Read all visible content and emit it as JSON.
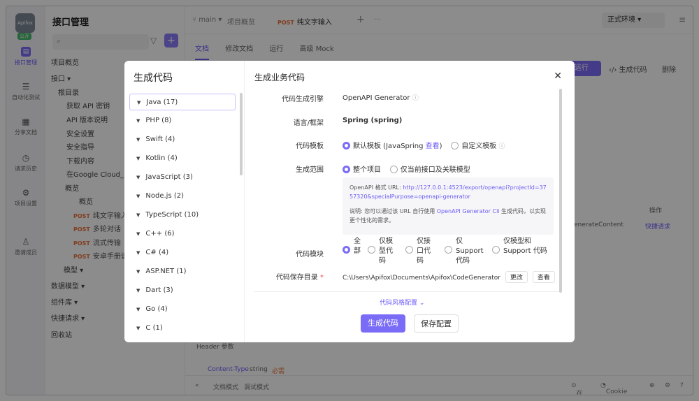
{
  "rail": {
    "logo": "Apifox",
    "open_badge": "公开",
    "items": [
      {
        "label": "接口管理",
        "icon": "api-icon"
      },
      {
        "label": "自动化测试",
        "icon": "test-icon"
      },
      {
        "label": "分享文档",
        "icon": "share-doc-icon"
      },
      {
        "label": "请求历史",
        "icon": "history-icon"
      },
      {
        "label": "项目设置",
        "icon": "settings-icon"
      },
      {
        "label": "邀请成员",
        "icon": "invite-icon"
      }
    ]
  },
  "tree": {
    "title": "接口管理",
    "search_icon": "search-icon",
    "nodes": [
      {
        "label": "项目概览"
      },
      {
        "label": "接口 ▾"
      },
      {
        "label": "根目录"
      },
      {
        "label": "获取 API 密钥"
      },
      {
        "label": "API 版本说明"
      },
      {
        "label": "安全设置"
      },
      {
        "label": "安全指导"
      },
      {
        "label": "下载内容"
      },
      {
        "label": "在Google Cloud_"
      },
      {
        "label": "概览"
      },
      {
        "label": "概览"
      },
      {
        "label": "纯文字输入",
        "method": "POST"
      },
      {
        "label": "多轮对话（",
        "method": "POST"
      },
      {
        "label": "流式传输",
        "method": "POST"
      },
      {
        "label": "安卓手册说明",
        "method": "POST"
      },
      {
        "label": "模型 ▾"
      },
      {
        "label": "数据模型 ▾"
      },
      {
        "label": "组件库 ▾"
      },
      {
        "label": "快捷请求 ▾"
      },
      {
        "label": "回收站"
      }
    ]
  },
  "topbar": {
    "branch": "main",
    "overview_tab": "项目概览",
    "active_tab_method": "POST",
    "active_tab_label": "纯文字输入",
    "env": "正式环境"
  },
  "subtabs": [
    "文档",
    "修改文档",
    "运行",
    "高级 Mock"
  ],
  "toolbar": {
    "run": "运行",
    "generate": "生成代码",
    "delete": "删除"
  },
  "background": {
    "header_params": "Header 参数",
    "content_type": "Content-Type",
    "string": "string",
    "required": "必需",
    "ops": "操作",
    "generate_content": "enerateContent",
    "quick_request": "快捷请求"
  },
  "statusbar": {
    "doc_mode": "文档模式",
    "debug_mode": "调试模式",
    "online": "在线",
    "cookie": "Cookie 管理"
  },
  "modal": {
    "left_title": "生成代码",
    "languages": [
      {
        "name": "Java",
        "count": "(17)"
      },
      {
        "name": "PHP",
        "count": "(8)"
      },
      {
        "name": "Swift",
        "count": "(4)"
      },
      {
        "name": "Kotlin",
        "count": "(4)"
      },
      {
        "name": "JavaScript",
        "count": "(3)"
      },
      {
        "name": "Node.js",
        "count": "(2)"
      },
      {
        "name": "TypeScript",
        "count": "(10)"
      },
      {
        "name": "C++",
        "count": "(6)"
      },
      {
        "name": "C#",
        "count": "(4)"
      },
      {
        "name": "ASP.NET",
        "count": "(1)"
      },
      {
        "name": "Dart",
        "count": "(3)"
      },
      {
        "name": "Go",
        "count": "(4)"
      },
      {
        "name": "C",
        "count": "(1)"
      }
    ],
    "right_title": "生成业务代码",
    "engine_label": "代码生成引擎",
    "engine_value": "OpenAPI Generator",
    "lang_label": "语言/框架",
    "lang_value": "Spring (spring)",
    "template_label": "代码模板",
    "template_default": "默认模板 (JavaSpring ",
    "template_view": "查看",
    "template_default_end": ")",
    "template_custom": "自定义模板",
    "scope_label": "生成范围",
    "scope_all": "整个项目",
    "scope_current": "仅当前接口及关联模型",
    "url_prefix": "OpenAPI 格式 URL: ",
    "url": "http://127.0.0.1:4523/export/openapi?projectId=3757320&specialPurpose=openapi-generator",
    "note_prefix": "说明: 您可以通过该 URL 自行使用 ",
    "note_link": "OpenAPI Generator Cli",
    "note_suffix": " 生成代码，以实现更个性化的需求。",
    "module_label": "代码模块",
    "modules": [
      {
        "label": "全\n部"
      },
      {
        "label": "仅模\n型代\n码"
      },
      {
        "label": "仅接\n口代\n码"
      },
      {
        "label": "仅\nSupport\n代码"
      },
      {
        "label": "仅模型和\nSupport 代码"
      }
    ],
    "dir_label": "代码保存目录",
    "dir_value": "C:\\Users\\Apifox\\Documents\\Apifox\\CodeGenerator",
    "change": "更改",
    "view": "查看",
    "advanced": "代码风格配置",
    "generate_button": "生成代码",
    "save_button": "保存配置"
  }
}
